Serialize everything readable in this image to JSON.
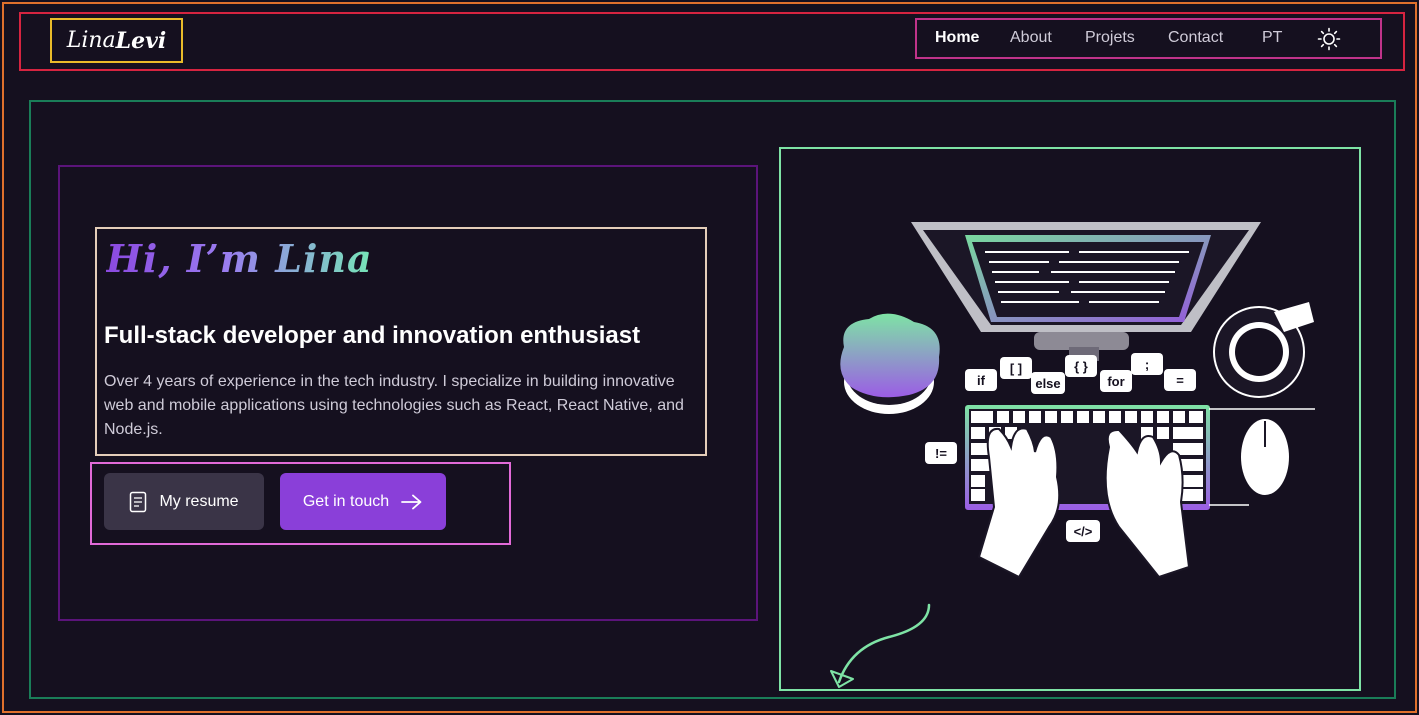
{
  "header": {
    "logo": {
      "part1": "Lina",
      "part2": "Levi"
    },
    "nav": [
      {
        "label": "Home",
        "active": true
      },
      {
        "label": "About",
        "active": false
      },
      {
        "label": "Projets",
        "active": false
      },
      {
        "label": "Contact",
        "active": false
      },
      {
        "label": "PT",
        "active": false
      }
    ],
    "theme_icon": "sun-icon"
  },
  "hero": {
    "greeting": "Hi, I’m Lina",
    "headline": "Full-stack developer and innovation enthusiast",
    "description": "Over 4 years of experience in the tech industry. I specialize in building innovative web and mobile applications using technologies such as React, React Native, and Node.js.",
    "buttons": {
      "resume": {
        "label": "My resume",
        "icon": "document-icon"
      },
      "contact": {
        "label": "Get in touch",
        "icon": "arrow-right-icon"
      }
    }
  },
  "illustration": {
    "code_bubbles": [
      "if",
      "[ ]",
      "else",
      "{ }",
      "for",
      ";",
      "=",
      "!=",
      "</>"
    ]
  },
  "colors": {
    "background": "#15101f",
    "accent": "#8a3fd9",
    "green": "#7ee3a5",
    "secondary_button": "#3a3447"
  }
}
